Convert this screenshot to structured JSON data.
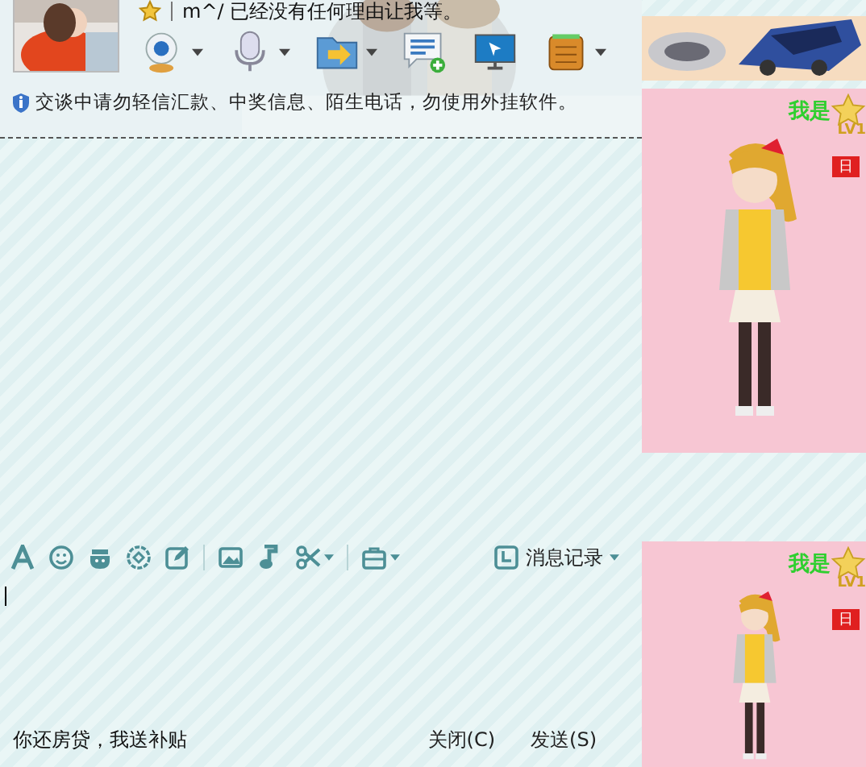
{
  "contact": {
    "status_text": "m^/ 已经没有任何理由让我等。"
  },
  "notice": "交谈中请勿轻信汇款、中奖信息、陌生电话，勿使用外挂软件。",
  "history_button": "消息记录",
  "ad_link": "你还房贷，我送补贴",
  "buttons": [
    {
      "label": "关闭(C)"
    },
    {
      "label": "发送(S)"
    }
  ],
  "show_panels": [
    {
      "name_text": "我是",
      "level_text": "LV1",
      "badge": "日"
    },
    {
      "name_text": "我是",
      "level_text": "LV1",
      "badge": "日"
    }
  ]
}
